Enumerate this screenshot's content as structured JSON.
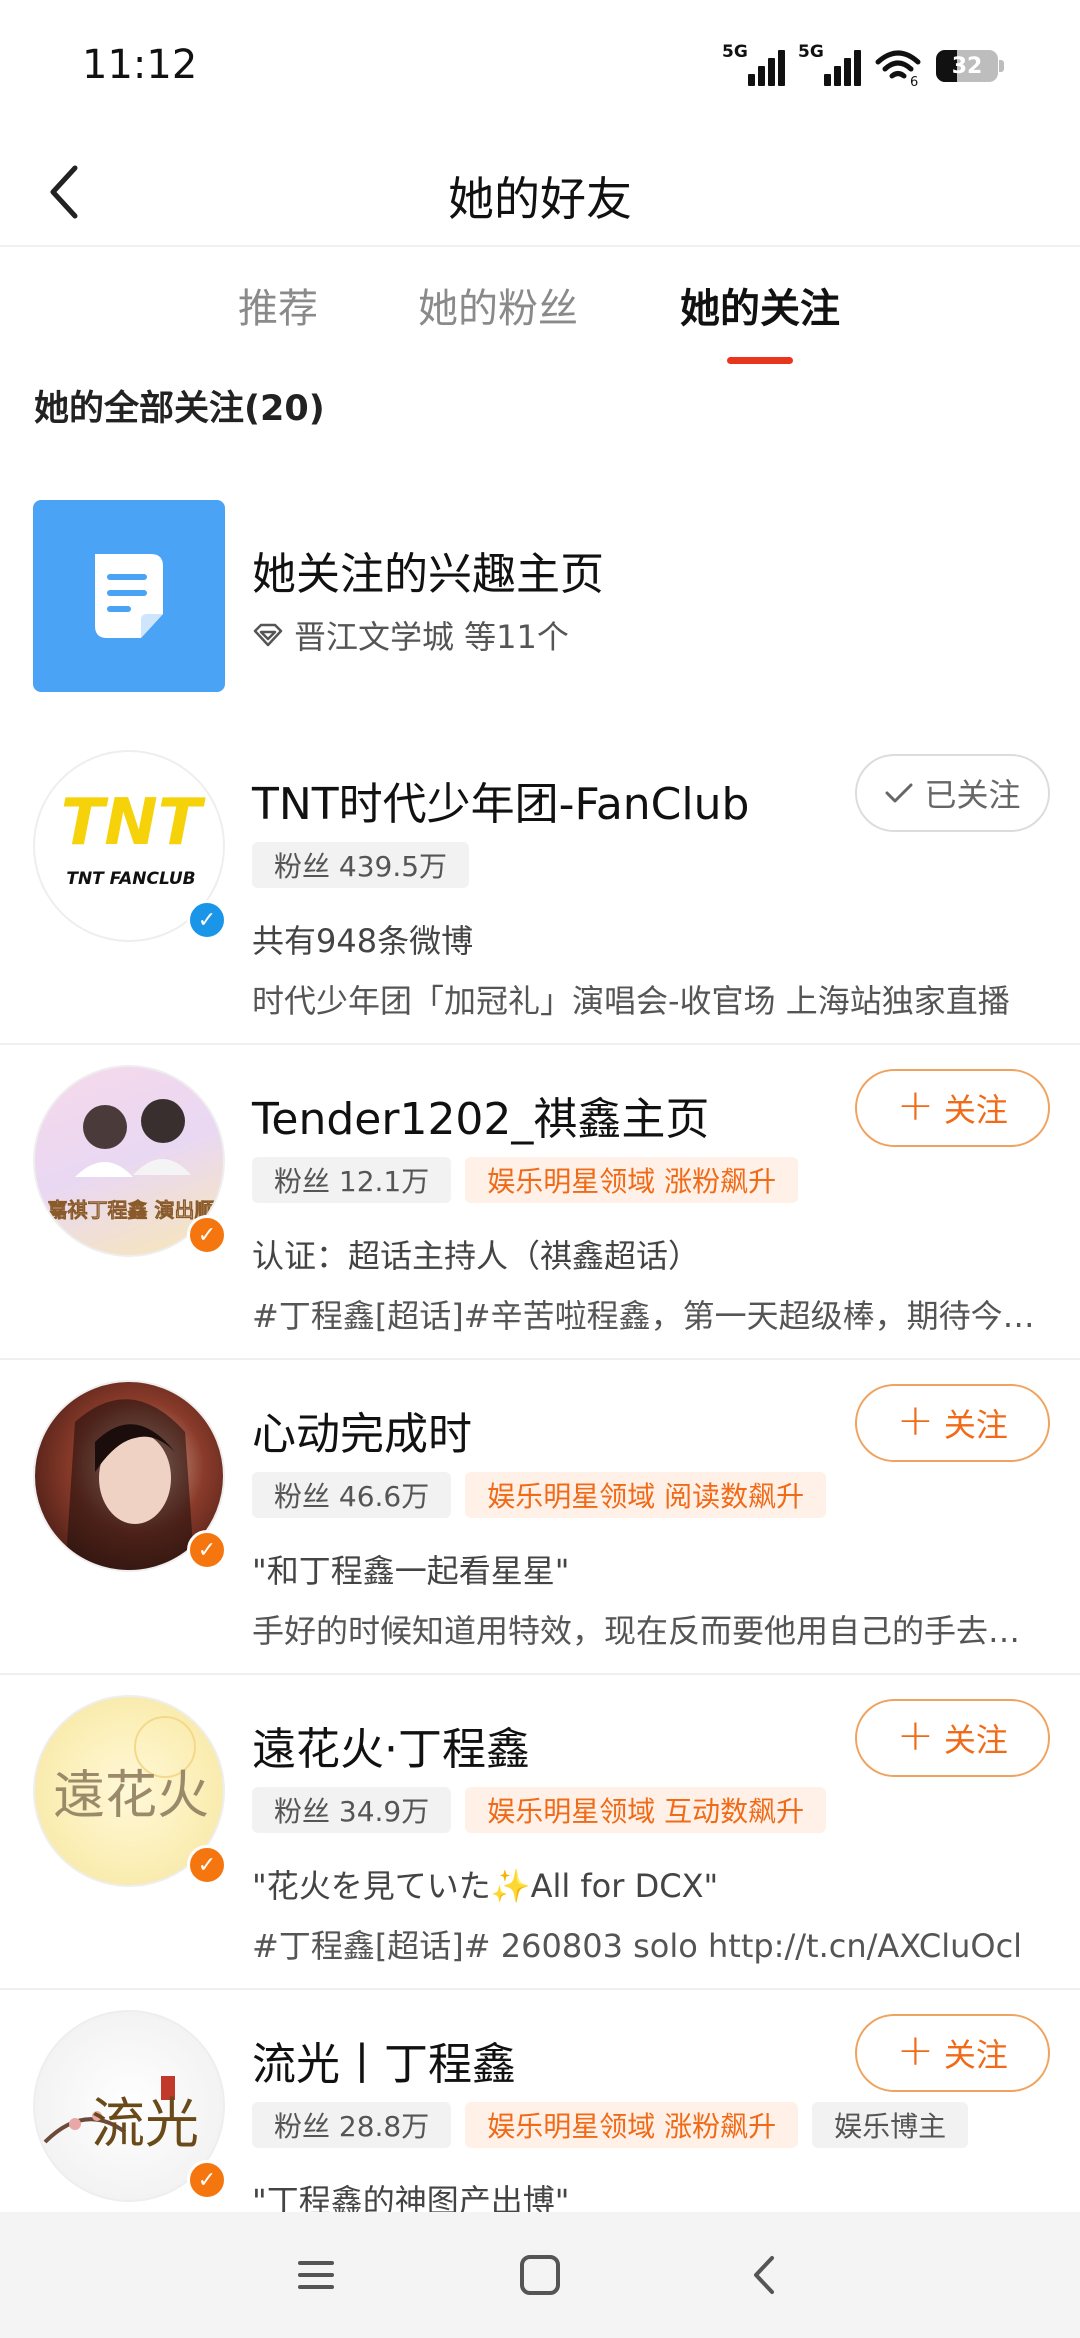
{
  "status_bar": {
    "time": "11:12",
    "signal1_label": "5G",
    "signal2_label": "5G",
    "wifi_label": "6",
    "battery": "32"
  },
  "header": {
    "title": "她的好友",
    "back_icon": "chevron-left-icon"
  },
  "tabs": [
    {
      "label": "推荐",
      "active": false
    },
    {
      "label": "她的粉丝",
      "active": false
    },
    {
      "label": "她的关注",
      "active": true
    }
  ],
  "section": {
    "title": "她的全部关注(20)"
  },
  "interest": {
    "name": "她关注的兴趣主页",
    "sub": "晋江文学城 等11个",
    "icon": "document-icon",
    "cover_color": "#4aa3f5"
  },
  "users": [
    {
      "name": "TNT时代少年团-FanClub",
      "followers": "粉丝 439.5万",
      "tags": [],
      "line1": "共有948条微博",
      "line2": "时代少年团「加冠礼」演唱会-收官场 上海站独家直播",
      "button": "已关注",
      "followed": true,
      "badge": "blue",
      "avatar_text": "TNT FANCLUB"
    },
    {
      "name": "Tender1202_祺鑫主页",
      "followers": "粉丝 12.1万",
      "tags": [
        "娱乐明星领域 涨粉飙升"
      ],
      "line1": "认证：超话主持人（祺鑫超话）",
      "line2": "#丁程鑫[超话]#辛苦啦程鑫，第一天超级棒，期待今天的演出",
      "button": "关注",
      "followed": false,
      "badge": "orange",
      "avatar_text": "马嘉祺丁程鑫 演出顺利"
    },
    {
      "name": "心动完成时",
      "followers": "粉丝 46.6万",
      "tags": [
        "娱乐明星领域 阅读数飙升"
      ],
      "line1": "\"和丁程鑫一起看星星\"",
      "line2": "手好的时候知道用特效，现在反而要他用自己的手去比划",
      "button": "关注",
      "followed": false,
      "badge": "orange",
      "avatar_text": ""
    },
    {
      "name": "遠花火·丁程鑫",
      "followers": "粉丝 34.9万",
      "tags": [
        "娱乐明星领域 互动数飙升"
      ],
      "line1": "\"花火を見ていた✨All for DCX\"",
      "line2": "#丁程鑫[超话]# 260803 solo http://t.cn/AXCluOcl",
      "button": "关注",
      "followed": false,
      "badge": "orange",
      "avatar_text": "遠花火"
    },
    {
      "name": "流光丨丁程鑫",
      "followers": "粉丝 28.8万",
      "tags": [
        "娱乐明星领域 涨粉飙升",
        "娱乐博主"
      ],
      "line1": "\"丁程鑫的神图产出博\"",
      "line2": "",
      "button": "关注",
      "followed": false,
      "badge": "orange",
      "avatar_text": "流光"
    }
  ],
  "nav_bar": {
    "menu_icon": "menu-icon",
    "home_icon": "home-square-icon",
    "back_icon": "back-triangle-icon"
  },
  "colors": {
    "accent": "#f06a17",
    "tab_underline": "#e8351c",
    "verified_blue": "#1b95e8",
    "verified_orange": "#f5760f"
  }
}
